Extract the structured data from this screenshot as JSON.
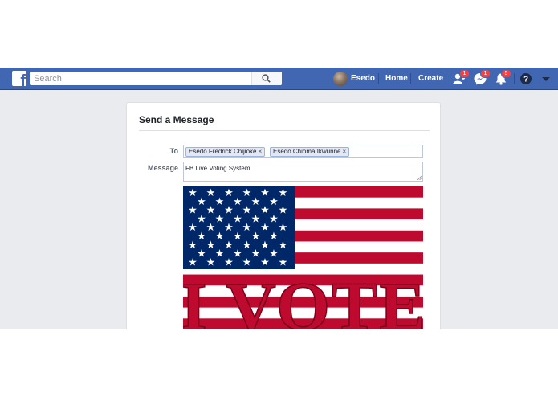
{
  "navbar": {
    "search_placeholder": "Search",
    "user_name": "Esedo",
    "home_label": "Home",
    "create_label": "Create",
    "friend_requests_badge": "1",
    "messages_badge": "1",
    "notifications_badge": "5",
    "colors": {
      "bar": "#4267b2",
      "badge": "#fa3e3e"
    }
  },
  "dialog": {
    "title": "Send a Message",
    "to_label": "To",
    "recipients": [
      {
        "name": "Esedo Fredrick Chijioke"
      },
      {
        "name": "Esedo Chioma Ikwunne"
      }
    ],
    "remove_glyph": "×",
    "message_label": "Message",
    "message_value": "FB Live Voting System",
    "attachment": {
      "text": "I VOTE",
      "colors": {
        "red": "#bf0a30",
        "blue": "#002868",
        "white": "#ffffff"
      }
    }
  }
}
